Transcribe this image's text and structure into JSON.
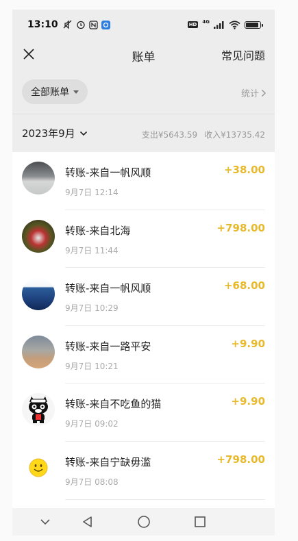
{
  "status_bar": {
    "time": "13:10",
    "network": "4G"
  },
  "nav": {
    "title": "账单",
    "help_label": "常见问题"
  },
  "filter": {
    "chip_label": "全部账单",
    "stats_label": "统计"
  },
  "month": {
    "label": "2023年9月",
    "expense": "支出¥5643.59",
    "income": "收入¥13735.42"
  },
  "transactions": [
    {
      "title": "转账-来自一帆风顺",
      "time": "9月7日 12:14",
      "amount": "+38.00",
      "avatar": "avatar-photo-landscape"
    },
    {
      "title": "转账-来自北海",
      "time": "9月7日 11:44",
      "amount": "+798.00",
      "avatar": "avatar-photo-cartoon"
    },
    {
      "title": "转账-来自一帆风顺",
      "time": "9月7日 10:29",
      "amount": "+68.00",
      "avatar": "avatar-photo-sea"
    },
    {
      "title": "转账-来自一路平安",
      "time": "9月7日 10:21",
      "amount": "+9.90",
      "avatar": "avatar-photo-beach"
    },
    {
      "title": "转账-来自不吃鱼的猫",
      "time": "9月7日 09:02",
      "amount": "+9.90",
      "avatar": "avatar-cat-icon"
    },
    {
      "title": "转账-来自宁缺毋滥",
      "time": "9月7日 08:08",
      "amount": "+798.00",
      "avatar": "avatar-smiley-icon"
    }
  ],
  "colors": {
    "amount": "#e8b92a",
    "background": "#ededed"
  }
}
